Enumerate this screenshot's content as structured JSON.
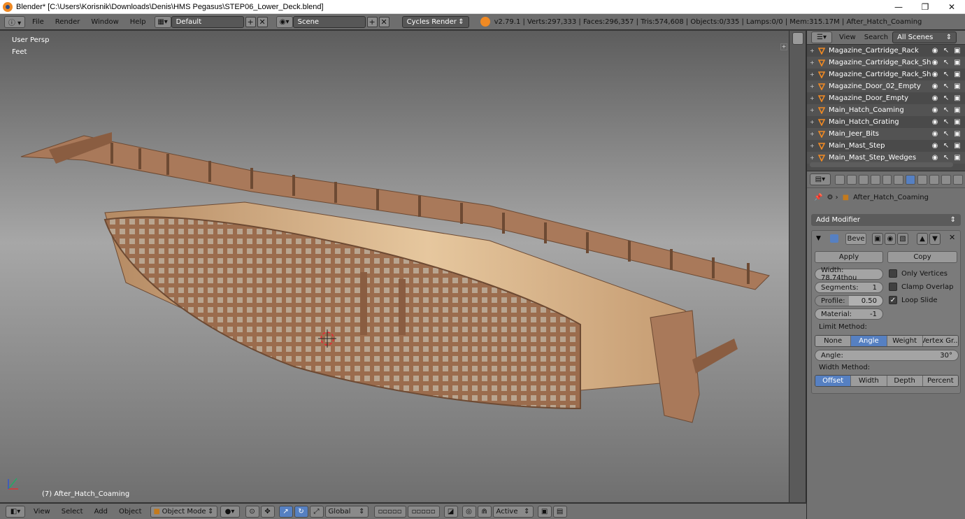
{
  "window": {
    "title": "Blender* [C:\\Users\\Korisnik\\Downloads\\Denis\\HMS Pegasus\\STEP06_Lower_Deck.blend]",
    "controls": [
      "—",
      "❐",
      "✕"
    ]
  },
  "topbar": {
    "menus": [
      "File",
      "Render",
      "Window",
      "Help"
    ],
    "layout": "Default",
    "scene": "Scene",
    "engine": "Cycles Render",
    "stats": "v2.79.1 | Verts:297,333 | Faces:296,357 | Tris:574,608 | Objects:0/335 | Lamps:0/0 | Mem:315.17M | After_Hatch_Coaming"
  },
  "viewport": {
    "view_name": "User Persp",
    "units": "Feet",
    "object_label": "(7) After_Hatch_Coaming",
    "colors": {
      "hull": "#a9795a",
      "frame": "#8a5d41",
      "deck": "#d9b58c"
    }
  },
  "bottombar": {
    "menus": [
      "View",
      "Select",
      "Add",
      "Object"
    ],
    "mode": "Object Mode",
    "orientation": "Global",
    "pivot": "Active"
  },
  "outliner": {
    "menus": [
      "View",
      "Search"
    ],
    "filter": "All Scenes",
    "items": [
      {
        "name": "Magazine_Cartridge_Rack"
      },
      {
        "name": "Magazine_Cartridge_Rack_She"
      },
      {
        "name": "Magazine_Cartridge_Rack_She"
      },
      {
        "name": "Magazine_Door_02_Empty"
      },
      {
        "name": "Magazine_Door_Empty"
      },
      {
        "name": "Main_Hatch_Coaming"
      },
      {
        "name": "Main_Hatch_Grating"
      },
      {
        "name": "Main_Jeer_Bits"
      },
      {
        "name": "Main_Mast_Step"
      },
      {
        "name": "Main_Mast_Step_Wedges"
      }
    ]
  },
  "properties": {
    "object_name": "After_Hatch_Coaming",
    "add_modifier": "Add Modifier",
    "modifier_name": "Beve",
    "apply": "Apply",
    "copy": "Copy",
    "width": "Width: 78.74thou",
    "segments_label": "Segments:",
    "segments_value": "1",
    "profile_label": "Profile:",
    "profile_value": "0.50",
    "material_label": "Material:",
    "material_value": "-1",
    "only_vertices": "Only Vertices",
    "clamp_overlap": "Clamp Overlap",
    "loop_slide": "Loop Slide",
    "limit_method_label": "Limit Method:",
    "limit_methods": [
      "None",
      "Angle",
      "Weight",
      "Vertex Gr..."
    ],
    "limit_active": "Angle",
    "angle_label": "Angle:",
    "angle_value": "30°",
    "width_method_label": "Width Method:",
    "width_methods": [
      "Offset",
      "Width",
      "Depth",
      "Percent"
    ],
    "width_active": "Offset"
  }
}
